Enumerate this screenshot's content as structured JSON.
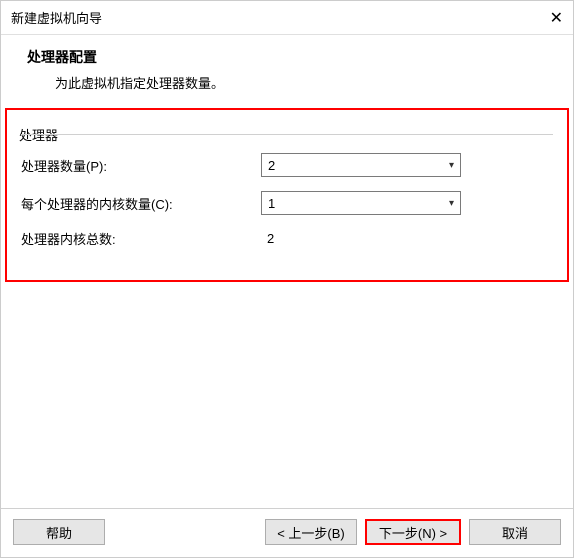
{
  "title": "新建虚拟机向导",
  "header": {
    "title": "处理器配置",
    "sub": "为此虚拟机指定处理器数量。"
  },
  "fieldset": {
    "legend": "处理器",
    "rows": {
      "count": {
        "label": "处理器数量(P):",
        "value": "2"
      },
      "cores": {
        "label": "每个处理器的内核数量(C):",
        "value": "1"
      },
      "total": {
        "label": "处理器内核总数:",
        "value": "2"
      }
    }
  },
  "buttons": {
    "help": "帮助",
    "back": "< 上一步(B)",
    "next": "下一步(N) >",
    "cancel": "取消"
  }
}
